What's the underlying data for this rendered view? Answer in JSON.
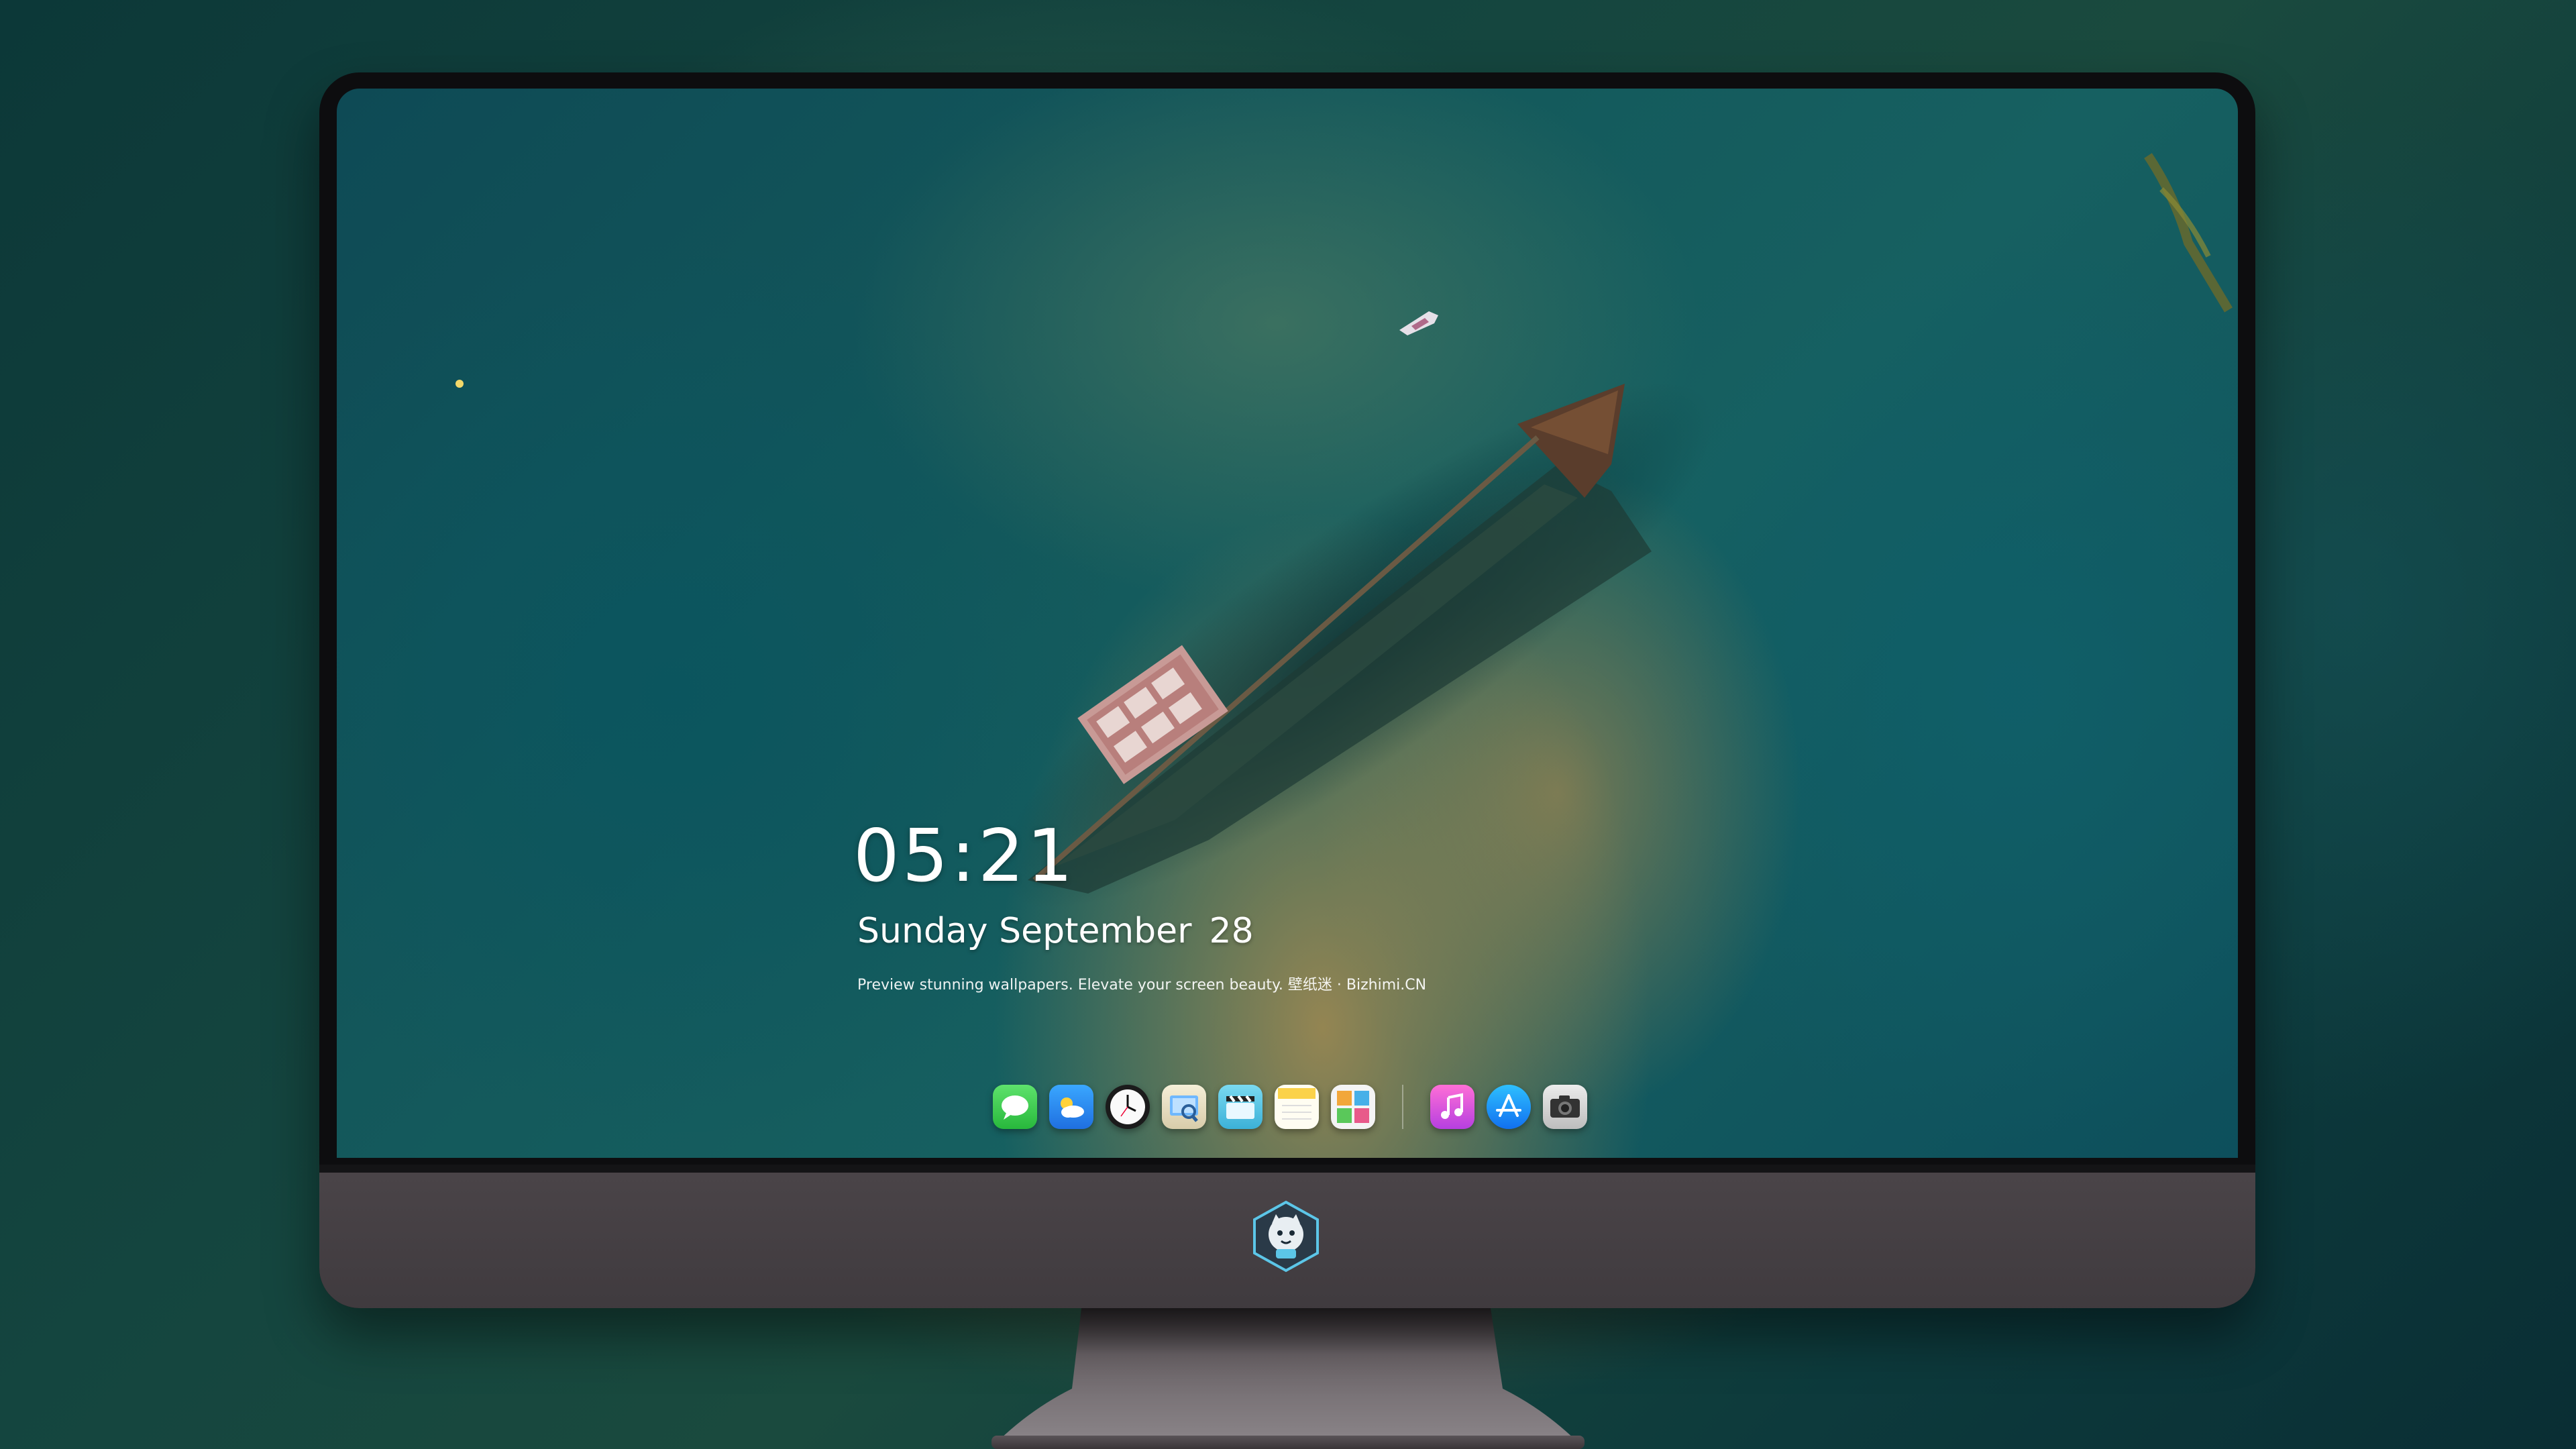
{
  "lock_screen": {
    "time": "05:21",
    "weekday_month": "Sunday September",
    "day": "28",
    "tagline": "Preview stunning wallpapers. Elevate your screen beauty. 壁纸迷 · Bizhimi.CN"
  },
  "dock": {
    "apps": [
      {
        "name": "messages-icon",
        "color": "#3ccf4e"
      },
      {
        "name": "weather-icon",
        "color": "#2b8df0"
      },
      {
        "name": "clock-icon",
        "color": "#f2f2f2"
      },
      {
        "name": "preview-icon",
        "color": "#e8e0c8"
      },
      {
        "name": "clips-icon",
        "color": "#5bc8e8"
      },
      {
        "name": "notes-icon",
        "color": "#fbd24a"
      },
      {
        "name": "photo-booth-icon",
        "color": "#ffffff"
      }
    ],
    "extras": [
      {
        "name": "music-icon",
        "color": "#f05acb"
      },
      {
        "name": "app-store-icon",
        "color": "#1c8ef5"
      },
      {
        "name": "camera-icon",
        "color": "#d8d8d8"
      }
    ]
  },
  "colors": {
    "monitor_bezel": "#0d0d0f",
    "monitor_chin": "#4a4448",
    "text": "#ffffff"
  }
}
